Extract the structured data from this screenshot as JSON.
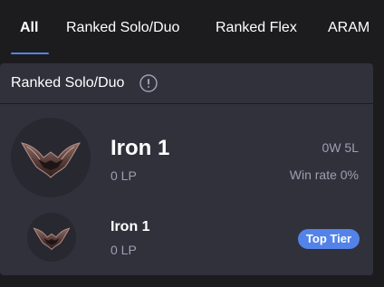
{
  "tabs": [
    {
      "label": "All",
      "active": true
    },
    {
      "label": "Ranked Solo/Duo",
      "active": false
    },
    {
      "label": "Ranked Flex",
      "active": false
    },
    {
      "label": "ARAM",
      "active": false
    }
  ],
  "card": {
    "title": "Ranked Solo/Duo",
    "info_icon": "info-circle-icon",
    "current": {
      "tier": "Iron 1",
      "lp": "0 LP",
      "record": "0W 5L",
      "win_rate": "Win rate 0%",
      "emblem": "iron-emblem-icon"
    },
    "peak": {
      "tier": "Iron 1",
      "lp": "0 LP",
      "badge": "Top Tier",
      "emblem": "iron-emblem-icon"
    }
  },
  "colors": {
    "background": "#1c1c1f",
    "card": "#31313c",
    "accent": "#5383e8",
    "muted_text": "#9e9eb1"
  }
}
